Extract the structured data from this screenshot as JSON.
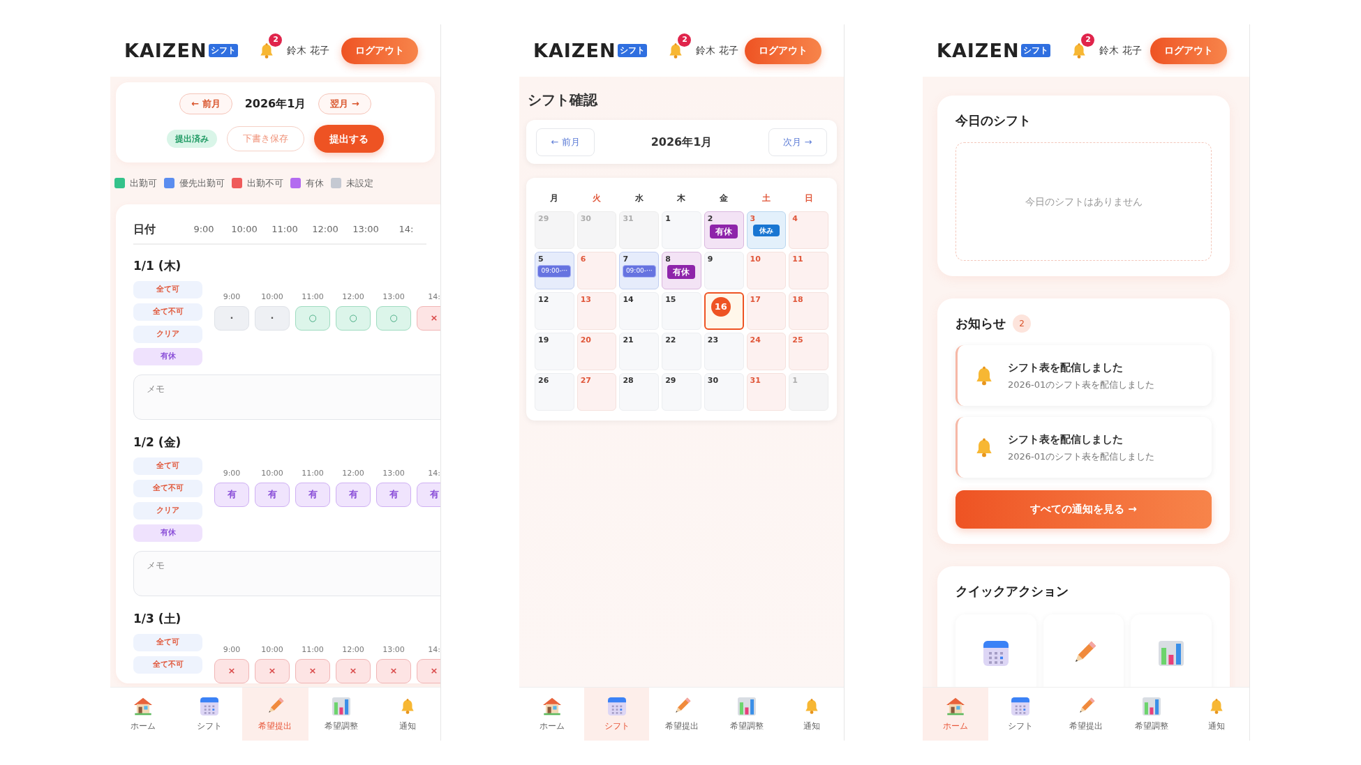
{
  "screens": [
    {
      "kind": "request",
      "header": {
        "logo": "KAIZEN",
        "logo_badge": "シフト",
        "notification_count": "2",
        "user_name": "鈴木 花子",
        "logout": "ログアウト"
      },
      "month_nav": {
        "prev": "← 前月",
        "month": "2026年1月",
        "next": "翌月 →"
      },
      "status_badge": "提出済み",
      "draft_button": "下書き保存",
      "submit_button": "提出する",
      "legend": [
        {
          "label": "出勤可",
          "color": "#34c28a"
        },
        {
          "label": "優先出勤可",
          "color": "#5b8def"
        },
        {
          "label": "出勤不可",
          "color": "#ef5b5b"
        },
        {
          "label": "有休",
          "color": "#b36bf0"
        },
        {
          "label": "未設定",
          "color": "#c5c9d2"
        }
      ],
      "table": {
        "date_header": "日付",
        "times": [
          "9:00",
          "10:00",
          "11:00",
          "12:00",
          "13:00",
          "14:"
        ]
      },
      "days": [
        {
          "date": "1/1 (木)",
          "actions": [
            {
              "label": "全て可",
              "kind": "bulk"
            },
            {
              "label": "全て不可",
              "kind": "bulk"
            },
            {
              "label": "クリア",
              "kind": "bulk"
            },
            {
              "label": "有休",
              "kind": "paid"
            }
          ],
          "slots": [
            {
              "time": "9:00",
              "kind": "unset",
              "mark": "·"
            },
            {
              "time": "10:00",
              "kind": "unset",
              "mark": "·"
            },
            {
              "time": "11:00",
              "kind": "ok",
              "mark": "○"
            },
            {
              "time": "12:00",
              "kind": "ok",
              "mark": "○"
            },
            {
              "time": "13:00",
              "kind": "ok",
              "mark": "○"
            },
            {
              "time": "14:",
              "kind": "ng",
              "mark": "×"
            }
          ],
          "memo_placeholder": "メモ"
        },
        {
          "date": "1/2 (金)",
          "actions": [
            {
              "label": "全て可",
              "kind": "bulk"
            },
            {
              "label": "全て不可",
              "kind": "bulk"
            },
            {
              "label": "クリア",
              "kind": "bulk"
            },
            {
              "label": "有休",
              "kind": "paid"
            }
          ],
          "slots": [
            {
              "time": "9:00",
              "kind": "paid",
              "mark": "有"
            },
            {
              "time": "10:00",
              "kind": "paid",
              "mark": "有"
            },
            {
              "time": "11:00",
              "kind": "paid",
              "mark": "有"
            },
            {
              "time": "12:00",
              "kind": "paid",
              "mark": "有"
            },
            {
              "time": "13:00",
              "kind": "paid",
              "mark": "有"
            },
            {
              "time": "14:",
              "kind": "paid",
              "mark": "有"
            }
          ],
          "memo_placeholder": "メモ"
        },
        {
          "date": "1/3 (土)",
          "actions": [
            {
              "label": "全て可",
              "kind": "bulk"
            },
            {
              "label": "全て不可",
              "kind": "bulk"
            }
          ],
          "slots": [
            {
              "time": "9:00",
              "kind": "ng",
              "mark": "×"
            },
            {
              "time": "10:00",
              "kind": "ng",
              "mark": "×"
            },
            {
              "time": "11:00",
              "kind": "ng",
              "mark": "×"
            },
            {
              "time": "12:00",
              "kind": "ng",
              "mark": "×"
            },
            {
              "time": "13:00",
              "kind": "ng",
              "mark": "×"
            },
            {
              "time": "14:",
              "kind": "ng",
              "mark": "×"
            }
          ]
        }
      ],
      "nav": [
        {
          "label": "ホーム",
          "selected": false
        },
        {
          "label": "シフト",
          "selected": false
        },
        {
          "label": "希望提出",
          "selected": true
        },
        {
          "label": "希望調整",
          "selected": false
        },
        {
          "label": "通知",
          "selected": false
        }
      ]
    },
    {
      "kind": "calendar",
      "header": {
        "logo": "KAIZEN",
        "logo_badge": "シフト",
        "notification_count": "2",
        "user_name": "鈴木 花子",
        "logout": "ログアウト"
      },
      "title": "シフト確認",
      "month_nav": {
        "prev": "← 前月",
        "month": "2026年1月",
        "next": "次月 →"
      },
      "weekdays": [
        {
          "label": "月",
          "red": false
        },
        {
          "label": "火",
          "red": true
        },
        {
          "label": "水",
          "red": false
        },
        {
          "label": "木",
          "red": false
        },
        {
          "label": "金",
          "red": false
        },
        {
          "label": "土",
          "red": true
        },
        {
          "label": "日",
          "red": true
        }
      ],
      "cells": [
        {
          "day": "29",
          "muted": true,
          "today": false
        },
        {
          "day": "30",
          "muted": true,
          "today": false
        },
        {
          "day": "31",
          "muted": true,
          "today": false
        },
        {
          "day": "1",
          "muted": false,
          "today": false
        },
        {
          "day": "2",
          "muted": false,
          "today": false,
          "event": {
            "label": "有休",
            "kind": "paid"
          }
        },
        {
          "day": "3",
          "muted": false,
          "today": false,
          "event": {
            "label": "休み",
            "kind": "off"
          }
        },
        {
          "day": "4",
          "muted": false,
          "today": false
        },
        {
          "day": "5",
          "muted": false,
          "today": false,
          "event": {
            "label": "09:00-···",
            "kind": "shift"
          }
        },
        {
          "day": "6",
          "muted": false,
          "today": false
        },
        {
          "day": "7",
          "muted": false,
          "today": false,
          "event": {
            "label": "09:00-···",
            "kind": "shift"
          }
        },
        {
          "day": "8",
          "muted": false,
          "today": false,
          "event": {
            "label": "有休",
            "kind": "paid"
          }
        },
        {
          "day": "9",
          "muted": false,
          "today": false
        },
        {
          "day": "10",
          "muted": false,
          "today": false
        },
        {
          "day": "11",
          "muted": false,
          "today": false
        },
        {
          "day": "12",
          "muted": false,
          "today": false
        },
        {
          "day": "13",
          "muted": false,
          "today": false
        },
        {
          "day": "14",
          "muted": false,
          "today": false
        },
        {
          "day": "15",
          "muted": false,
          "today": false
        },
        {
          "day": "16",
          "muted": false,
          "today": true
        },
        {
          "day": "17",
          "muted": false,
          "today": false
        },
        {
          "day": "18",
          "muted": false,
          "today": false
        },
        {
          "day": "19",
          "muted": false,
          "today": false
        },
        {
          "day": "20",
          "muted": false,
          "today": false
        },
        {
          "day": "21",
          "muted": false,
          "today": false
        },
        {
          "day": "22",
          "muted": false,
          "today": false
        },
        {
          "day": "23",
          "muted": false,
          "today": false
        },
        {
          "day": "24",
          "muted": false,
          "today": false
        },
        {
          "day": "25",
          "muted": false,
          "today": false
        },
        {
          "day": "26",
          "muted": false,
          "today": false
        },
        {
          "day": "27",
          "muted": false,
          "today": false
        },
        {
          "day": "28",
          "muted": false,
          "today": false
        },
        {
          "day": "29",
          "muted": false,
          "today": false
        },
        {
          "day": "30",
          "muted": false,
          "today": false
        },
        {
          "day": "31",
          "muted": false,
          "today": false
        },
        {
          "day": "1",
          "muted": true,
          "today": false
        }
      ],
      "nav": [
        {
          "label": "ホーム",
          "selected": false
        },
        {
          "label": "シフト",
          "selected": true
        },
        {
          "label": "希望提出",
          "selected": false
        },
        {
          "label": "希望調整",
          "selected": false
        },
        {
          "label": "通知",
          "selected": false
        }
      ]
    },
    {
      "kind": "home",
      "header": {
        "logo": "KAIZEN",
        "logo_badge": "シフト",
        "notification_count": "2",
        "user_name": "鈴木 花子",
        "logout": "ログアウト"
      },
      "today": {
        "title": "今日のシフト",
        "empty": "今日のシフトはありません"
      },
      "notices": {
        "title": "お知らせ",
        "count": "2",
        "items": [
          {
            "title": "シフト表を配信しました",
            "body": "2026-01のシフト表を配信しました"
          },
          {
            "title": "シフト表を配信しました",
            "body": "2026-01のシフト表を配信しました"
          }
        ],
        "button": "すべての通知を見る →"
      },
      "quick_actions": {
        "title": "クイックアクション"
      },
      "nav": [
        {
          "label": "ホーム",
          "selected": true
        },
        {
          "label": "シフト",
          "selected": false
        },
        {
          "label": "希望提出",
          "selected": false
        },
        {
          "label": "希望調整",
          "selected": false
        },
        {
          "label": "通知",
          "selected": false
        }
      ]
    }
  ]
}
